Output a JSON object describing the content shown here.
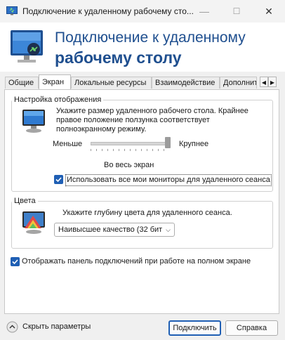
{
  "window": {
    "title": "Подключение к удаленному рабочему сто...",
    "minimize_glyph": "—",
    "maximize_glyph": "☐",
    "close_glyph": "✕"
  },
  "header": {
    "title_line1": "Подключение к удаленному",
    "title_line2": "рабочему столу"
  },
  "tabs": [
    {
      "label": "Общие"
    },
    {
      "label": "Экран"
    },
    {
      "label": "Локальные ресурсы"
    },
    {
      "label": "Взаимодействие"
    },
    {
      "label": "Дополнит"
    }
  ],
  "active_tab": "Экран",
  "display": {
    "legend": "Настройка отображения",
    "description": [
      "Укажите размер удаленного рабочего стола. Крайнее",
      "правое положение ползунка соответствует",
      "полноэкранному режиму."
    ],
    "slider_min_label": "Меньше",
    "slider_max_label": "Крупнее",
    "slider_value_label": "Во весь экран",
    "slider_position": 1.0,
    "all_monitors_label": "Использовать все мои мониторы для удаленного сеанса",
    "all_monitors_checked": true
  },
  "colors": {
    "legend": "Цвета",
    "description": "Укажите глубину цвета для удаленного сеанса.",
    "selected": "Наивысшее качество (32 бит"
  },
  "connection_bar": {
    "label": "Отображать панель подключений при работе на полном экране",
    "checked": true
  },
  "footer": {
    "hide_options_label": "Скрыть параметры",
    "connect_label": "Подключить",
    "help_label": "Справка"
  },
  "theme": {
    "accent": "#1f5fb4",
    "title_color": "#1f4f8f"
  }
}
